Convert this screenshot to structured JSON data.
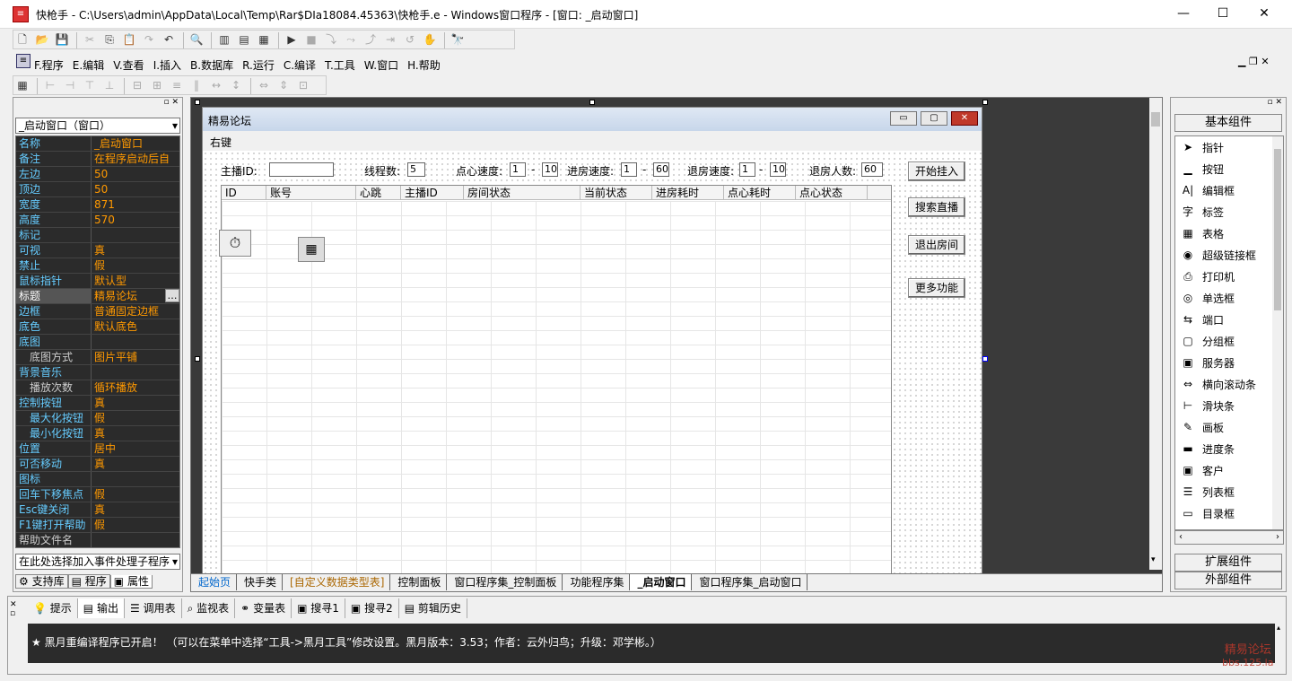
{
  "window": {
    "title": "快枪手 - C:\\Users\\admin\\AppData\\Local\\Temp\\Rar$DIa18084.45363\\快枪手.e - Windows窗口程序 - [窗口: _启动窗口]",
    "minimize": "—",
    "maximize": "☐",
    "close": "✕"
  },
  "menu": [
    "F.程序",
    "E.编辑",
    "V.查看",
    "I.插入",
    "B.数据库",
    "R.运行",
    "C.编译",
    "T.工具",
    "W.窗口",
    "H.帮助"
  ],
  "left": {
    "selector": "_启动窗口（窗口）",
    "props": [
      {
        "k": "名称",
        "v": "_启动窗口"
      },
      {
        "k": "备注",
        "v": "在程序启动后自"
      },
      {
        "k": "左边",
        "v": "50"
      },
      {
        "k": "顶边",
        "v": "50"
      },
      {
        "k": "宽度",
        "v": "871"
      },
      {
        "k": "高度",
        "v": "570"
      },
      {
        "k": "标记",
        "v": ""
      },
      {
        "k": "可视",
        "v": "真"
      },
      {
        "k": "禁止",
        "v": "假"
      },
      {
        "k": "鼠标指针",
        "v": "默认型"
      },
      {
        "k": "标题",
        "v": "精易论坛",
        "sel": true
      },
      {
        "k": "边框",
        "v": "普通固定边框"
      },
      {
        "k": "底色",
        "v": "默认底色"
      },
      {
        "k": "底图",
        "v": ""
      },
      {
        "k": "底图方式",
        "v": "图片平铺",
        "sub": true,
        "dim": true
      },
      {
        "k": "背景音乐",
        "v": ""
      },
      {
        "k": "播放次数",
        "v": "循环播放",
        "sub": true,
        "dim": true
      },
      {
        "k": "控制按钮",
        "v": "真"
      },
      {
        "k": "最大化按钮",
        "v": "假",
        "sub": true
      },
      {
        "k": "最小化按钮",
        "v": "真",
        "sub": true
      },
      {
        "k": "位置",
        "v": "居中"
      },
      {
        "k": "可否移动",
        "v": "真"
      },
      {
        "k": "图标",
        "v": ""
      },
      {
        "k": "回车下移焦点",
        "v": "假"
      },
      {
        "k": "Esc键关闭",
        "v": "真"
      },
      {
        "k": "F1键打开帮助",
        "v": "假"
      },
      {
        "k": "帮助文件名",
        "v": "",
        "dim": true
      }
    ],
    "event_select": "在此处选择加入事件处理子程序",
    "tabs": [
      "支持库",
      "程序",
      "属性"
    ]
  },
  "form": {
    "title": "精易论坛",
    "menu_label": "右键",
    "fields": {
      "anchor_label": "主播ID:",
      "anchor_value": "",
      "threads_label": "线程数:",
      "threads_value": "5",
      "speed_label": "点心速度:",
      "speed_min": "1",
      "dash1": "-",
      "speed_max": "10",
      "enter_label": "进房速度:",
      "enter_min": "1",
      "dash2": "-",
      "enter_max": "60",
      "exit_label": "退房速度:",
      "exit_min": "1",
      "dash3": "-",
      "exit_max": "10",
      "count_label": "退房人数:",
      "count_value": "60"
    },
    "columns": [
      "ID",
      "账号",
      "心跳",
      "主播ID",
      "房间状态",
      "当前状态",
      "进房耗时",
      "点心耗时",
      "点心状态"
    ],
    "buttons": [
      "开始挂入",
      "搜索直播",
      "退出房间",
      "更多功能"
    ]
  },
  "doc_tabs": [
    "起始页",
    "快手类",
    "[自定义数据类型表]",
    "控制面板",
    "窗口程序集_控制面板",
    "功能程序集",
    "_启动窗口",
    "窗口程序集_启动窗口"
  ],
  "right": {
    "header": "基本组件",
    "items": [
      {
        "icon": "➤",
        "label": "指针"
      },
      {
        "icon": "▁",
        "label": "按钮"
      },
      {
        "icon": "A|",
        "label": "编辑框"
      },
      {
        "icon": "字",
        "label": "标签"
      },
      {
        "icon": "▦",
        "label": "表格"
      },
      {
        "icon": "◉",
        "label": "超级链接框"
      },
      {
        "icon": "⎙",
        "label": "打印机"
      },
      {
        "icon": "◎",
        "label": "单选框"
      },
      {
        "icon": "⇆",
        "label": "端口"
      },
      {
        "icon": "▢",
        "label": "分组框"
      },
      {
        "icon": "▣",
        "label": "服务器"
      },
      {
        "icon": "⇔",
        "label": "横向滚动条"
      },
      {
        "icon": "⊢",
        "label": "滑块条"
      },
      {
        "icon": "✎",
        "label": "画板"
      },
      {
        "icon": "▬",
        "label": "进度条"
      },
      {
        "icon": "▣",
        "label": "客户"
      },
      {
        "icon": "☰",
        "label": "列表框"
      },
      {
        "icon": "▭",
        "label": "目录框"
      }
    ],
    "ext": "扩展组件",
    "outer": "外部组件"
  },
  "output": {
    "tabs": [
      "提示",
      "输出",
      "调用表",
      "监视表",
      "变量表",
      "搜寻1",
      "搜寻2",
      "剪辑历史"
    ],
    "message": "★ 黑月重编译程序已开启！ （可以在菜单中选择“工具->黑月工具”修改设置。黑月版本：3.53；作者：云外归鸟；升级：邓学彬。）"
  },
  "watermark": {
    "line1": "精易论坛",
    "line2": "bbs.125.la"
  }
}
